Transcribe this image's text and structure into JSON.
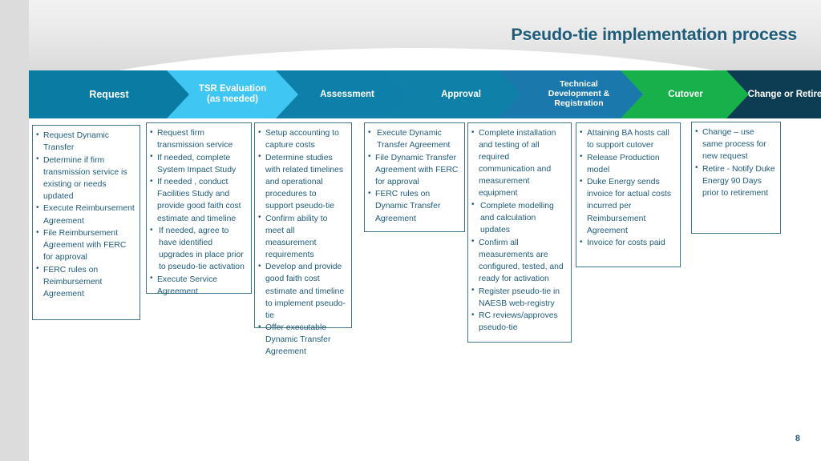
{
  "slide": {
    "title": "Pseudo-tie implementation process",
    "page_number": "8",
    "accent_colors": {
      "title_blue": "#1f5c7a",
      "body_blue": "#1f5c7a",
      "box_border": "#41738a",
      "left_band_gray": "#dcdcdc"
    }
  },
  "process": {
    "stages": [
      {
        "id": "request",
        "label_line1": "Request",
        "label_line2": "",
        "color": "#0a7ba3",
        "font_size": 12.5,
        "bullets": [
          "Request Dynamic Transfer",
          "Determine if firm transmission service is existing or needs updated",
          "Execute Reimbursement Agreement",
          "File Reimbursement Agreement with FERC for approval",
          "FERC rules on Reimbursement Agreement"
        ]
      },
      {
        "id": "tsr-evaluation",
        "label_line1": "TSR Evaluation",
        "label_line2": "(as needed)",
        "color": "#3fc6f2",
        "font_size": 11.5,
        "bullets": [
          "Request firm transmission service",
          "If needed, complete System Impact Study",
          "If needed , conduct Facilities Study and provide good faith cost estimate and timeline",
          " If needed, agree to have identified upgrades in place prior to pseudo-tie activation",
          "Execute Service Agreement"
        ]
      },
      {
        "id": "assessment",
        "label_line1": "Assessment",
        "label_line2": "",
        "color": "#0d7fa8",
        "font_size": 11.5,
        "bullets": [
          "Setup accounting to capture costs",
          "Determine studies with related timelines and operational procedures to support pseudo-tie",
          "Confirm ability to meet all measurement requirements",
          "Develop and provide good faith cost estimate and timeline to implement pseudo-tie",
          "Offer executable Dynamic Transfer Agreement"
        ]
      },
      {
        "id": "approval",
        "label_line1": "Approval",
        "label_line2": "",
        "color": "#0f81a9",
        "font_size": 11.5,
        "bullets": [
          " Execute Dynamic Transfer Agreement",
          "File Dynamic Transfer Agreement with FERC for approval",
          "FERC rules on Dynamic Transfer Agreement"
        ]
      },
      {
        "id": "technical-development-registration",
        "label_line1": "Technical",
        "label_line2": "Development &",
        "label_line3": "Registration",
        "color": "#1a78ac",
        "font_size": 10.5,
        "bullets": [
          "Complete installation and testing of all required communication and measurement equipment",
          " Complete modelling and calculation updates",
          "Confirm all measurements are configured, tested, and ready for activation",
          "Register pseudo-tie in NAESB web-registry",
          "RC reviews/approves pseudo-tie"
        ]
      },
      {
        "id": "cutover",
        "label_line1": "Cutover",
        "label_line2": "",
        "color": "#17b04a",
        "font_size": 11.5,
        "bullets": [
          "Attaining BA hosts call to support cutover",
          "Release Production model",
          "Duke Energy sends invoice for actual costs incurred per Reimbursement Agreement",
          "Invoice for costs paid"
        ]
      },
      {
        "id": "change-or-retire",
        "label_line1": "Change or Retire",
        "label_line2": "",
        "color": "#0d3d52",
        "font_size": 11.5,
        "bullets": [
          "Change – use same process for new request",
          "Retire - Notify Duke Energy 90 Days prior to retirement"
        ]
      }
    ]
  }
}
